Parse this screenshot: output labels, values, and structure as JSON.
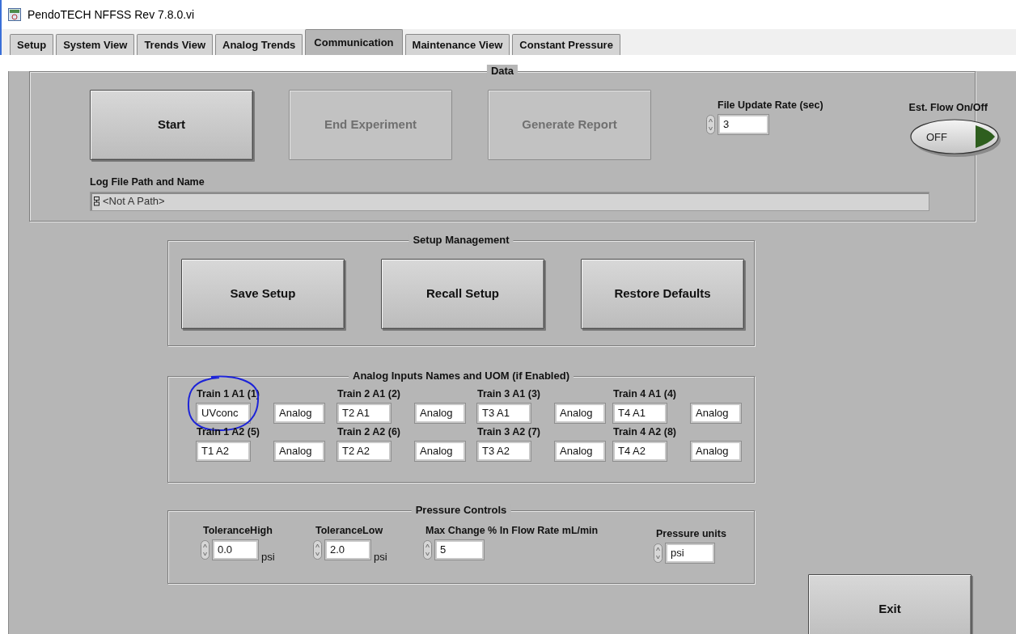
{
  "window": {
    "title": "PendoTECH NFFSS Rev 7.8.0.vi"
  },
  "tabs": [
    {
      "label": "Setup",
      "selected": false
    },
    {
      "label": "System View",
      "selected": false
    },
    {
      "label": "Trends View",
      "selected": false
    },
    {
      "label": "Analog Trends",
      "selected": false
    },
    {
      "label": "Communication",
      "selected": true
    },
    {
      "label": "Maintenance View",
      "selected": false
    },
    {
      "label": "Constant Pressure",
      "selected": false
    }
  ],
  "data": {
    "title": "Data",
    "buttons": [
      {
        "label": "Start",
        "disabled": false
      },
      {
        "label": "End Experiment",
        "disabled": true
      },
      {
        "label": "Generate Report",
        "disabled": true
      }
    ],
    "file_update_rate": {
      "label": "File Update Rate (sec)",
      "value": "3"
    },
    "est_flow": {
      "label": "Est. Flow On/Off",
      "text": "OFF",
      "on": false
    },
    "log_file": {
      "label": "Log File Path and Name",
      "value": "<Not A Path>"
    }
  },
  "setup_management": {
    "title": "Setup Management",
    "buttons": [
      "Save Setup",
      "Recall Setup",
      "Restore Defaults"
    ]
  },
  "analog_inputs": {
    "title": "Analog Inputs Names and UOM (if Enabled)",
    "inputs": [
      {
        "label": "Train 1 A1 (1)",
        "name": "UVconc",
        "uom": "Analog",
        "annotated": true
      },
      {
        "label": "Train 2 A1 (2)",
        "name": "T2 A1",
        "uom": "Analog",
        "annotated": false
      },
      {
        "label": "Train 3 A1 (3)",
        "name": "T3 A1",
        "uom": "Analog",
        "annotated": false
      },
      {
        "label": "Train 4 A1 (4)",
        "name": "T4 A1",
        "uom": "Analog",
        "annotated": false
      },
      {
        "label": "Train 1 A2 (5)",
        "name": "T1 A2",
        "uom": "Analog",
        "annotated": false
      },
      {
        "label": "Train 2 A2 (6)",
        "name": "T2 A2",
        "uom": "Analog",
        "annotated": false
      },
      {
        "label": "Train 3 A2 (7)",
        "name": "T3 A2",
        "uom": "Analog",
        "annotated": false
      },
      {
        "label": "Train 4 A2 (8)",
        "name": "T4 A2",
        "uom": "Analog",
        "annotated": false
      }
    ]
  },
  "pressure_controls": {
    "title": "Pressure Controls",
    "fields": [
      {
        "label": "ToleranceHigh",
        "value": "0.0",
        "unit": "psi"
      },
      {
        "label": "ToleranceLow",
        "value": "2.0",
        "unit": "psi"
      },
      {
        "label": "Max Change % In Flow Rate mL/min",
        "value": "5"
      },
      {
        "label": "Pressure units",
        "value": "psi"
      }
    ]
  },
  "exit_button": {
    "label": "Exit"
  }
}
